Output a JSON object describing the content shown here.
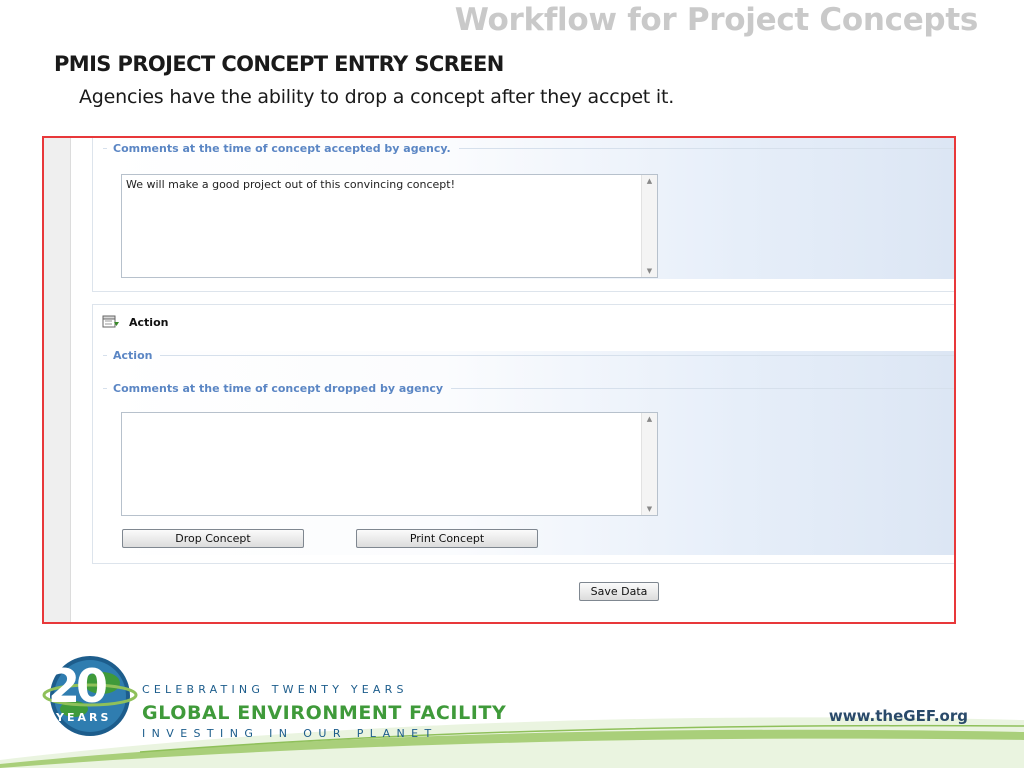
{
  "slide": {
    "title": "Workflow for Project Concepts",
    "heading": "PMIS PROJECT CONCEPT ENTRY SCREEN",
    "subtitle": "Agencies have the ability to drop a concept after they accpet it."
  },
  "form": {
    "accepted_section": {
      "legend": "Comments at the time of concept accepted by agency.",
      "comment_value": "We will make a good project out of this convincing concept!"
    },
    "action_panel": {
      "title": "Action",
      "action_legend": "Action",
      "dropped_legend": "Comments at the time of concept dropped by agency",
      "comment_value": "",
      "drop_button": "Drop Concept",
      "print_button": "Print Concept"
    },
    "save_button": "Save Data"
  },
  "footer": {
    "logo_number": "20",
    "logo_years": "YEARS",
    "celebrating": "CELEBRATING TWENTY YEARS",
    "org_name": "GLOBAL ENVIRONMENT FACILITY",
    "tagline": "INVESTING IN OUR PLANET",
    "url": "www.theGEF.org"
  },
  "colors": {
    "frame_border": "#e8383a",
    "legend_blue": "#5b86c4",
    "title_gray": "#c9c9c9",
    "gef_green": "#3f9a3a",
    "gef_blue": "#1d5d8c"
  }
}
